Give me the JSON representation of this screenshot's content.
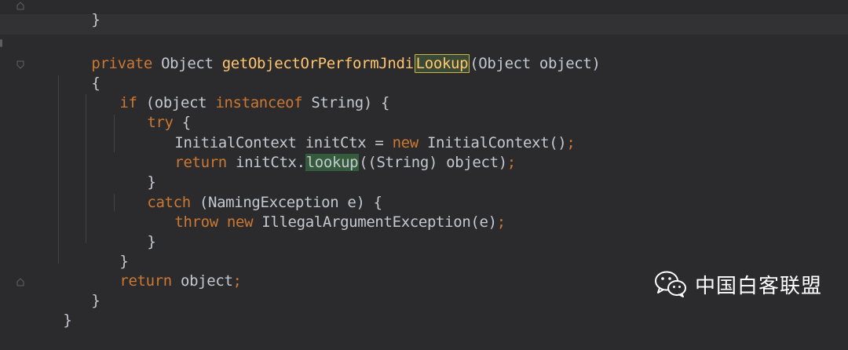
{
  "editor": {
    "colors": {
      "background": "#2b2b2d",
      "keyword": "#cc7832",
      "method": "#ffc66d",
      "text": "#c5c8d0"
    },
    "lines": {
      "l0": {
        "text": "}"
      },
      "l1": {
        "kw": "private",
        "type": " Object ",
        "fn_a": "getObjectOrPerformJndi",
        "fn_hl": "Lookup",
        "rest": "(Object object)"
      },
      "l2": {
        "text": "{"
      },
      "l3": {
        "kw1": "if",
        "mid": " (object ",
        "kw2": "instanceof",
        "rest": " String) {"
      },
      "l4": {
        "kw": "try",
        "rest": " {"
      },
      "l5": {
        "a": "InitialContext initCtx = ",
        "kw": "new",
        "b": " InitialContext()",
        "semi": ";"
      },
      "l6": {
        "kw": "return",
        "a": " initCtx.",
        "hl": "lookup",
        "b": "((String) object)",
        "semi": ";"
      },
      "l7": {
        "text": "}"
      },
      "l8": {
        "kw": "catch",
        "rest": " (NamingException e) {"
      },
      "l9": {
        "kw1": "throw",
        "sp": " ",
        "kw2": "new",
        "b": " IllegalArgumentException(e)",
        "semi": ";"
      },
      "l10": {
        "text": "}"
      },
      "l11": {
        "text": "}"
      },
      "l12": {
        "kw": "return",
        "b": " object",
        "semi": ";"
      },
      "l13": {
        "text": "}"
      },
      "l14": {
        "text": "}"
      }
    }
  },
  "watermark": {
    "icon": "wechat-icon",
    "text": "中国白客联盟"
  }
}
